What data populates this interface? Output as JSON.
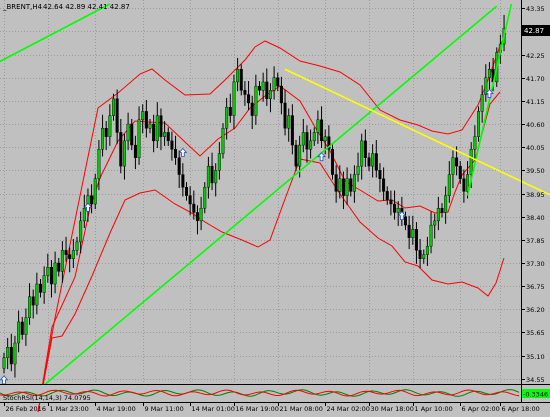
{
  "window_title": "_BRENT,H4",
  "ohlc_readout": "42.64 42.89 42.41 42.87",
  "current_price": "42.87",
  "indicator_label": "StochRSI(14,14,3) 74.0795",
  "indicator_value": "-0.3346",
  "colors": {
    "background": "#c0c0c0",
    "grid": "#9c9c9c",
    "bull": "#00c800",
    "bear": "#000000",
    "wick": "#000000",
    "bands": "#ff0000",
    "green_trend": "#00ff00",
    "yellow_trend": "#ffff00",
    "arrow": "#1e50c8",
    "price_tag_bg": "#000000",
    "price_tag_fg": "#ffffff",
    "indicator_value_bg": "#00ff00"
  },
  "chart_data": {
    "type": "candlestick",
    "symbol": "_BRENT",
    "timeframe": "H4",
    "ylim": [
      34.45,
      43.45
    ],
    "y_ticks": [
      "43.35",
      "42.80",
      "42.25",
      "41.70",
      "41.15",
      "40.60",
      "40.05",
      "39.50",
      "38.95",
      "38.40",
      "37.85",
      "37.30",
      "36.75",
      "36.20",
      "35.65",
      "35.10",
      "34.55"
    ],
    "x_ticks": [
      {
        "bar": 0,
        "label": "26 Feb 2016"
      },
      {
        "bar": 12,
        "label": "1 Mar 23:00"
      },
      {
        "bar": 25,
        "label": "4 Mar 19:00"
      },
      {
        "bar": 38,
        "label": "9 Mar 11:00"
      },
      {
        "bar": 51,
        "label": "14 Mar 01:00"
      },
      {
        "bar": 63,
        "label": "16 Mar 19:00"
      },
      {
        "bar": 75,
        "label": "21 Mar 08:00"
      },
      {
        "bar": 88,
        "label": "24 Mar 02:00"
      },
      {
        "bar": 100,
        "label": "30 Mar 18:00"
      },
      {
        "bar": 112,
        "label": "1 Apr 10:00"
      },
      {
        "bar": 125,
        "label": "6 Apr 02:00"
      },
      {
        "bar": 136,
        "label": "6 Apr 18:00"
      }
    ],
    "closes": [
      35.05,
      35.3,
      34.9,
      35.4,
      35.9,
      35.6,
      36.0,
      36.5,
      36.3,
      36.8,
      36.6,
      37.0,
      37.2,
      36.8,
      37.3,
      37.1,
      37.6,
      37.5,
      37.4,
      37.6,
      37.8,
      38.3,
      38.6,
      38.9,
      38.7,
      39.3,
      40.0,
      40.5,
      40.3,
      40.8,
      41.2,
      40.4,
      39.6,
      40.2,
      40.6,
      40.1,
      39.8,
      40.7,
      40.9,
      40.5,
      40.6,
      40.2,
      40.8,
      40.3,
      40.4,
      40.2,
      40.0,
      39.8,
      39.4,
      39.1,
      38.9,
      38.7,
      38.5,
      38.3,
      38.6,
      39.1,
      39.6,
      39.2,
      39.5,
      39.9,
      40.5,
      41.0,
      40.8,
      41.6,
      41.9,
      41.4,
      41.3,
      41.1,
      40.8,
      41.5,
      41.4,
      41.6,
      41.2,
      41.4,
      41.7,
      41.5,
      41.1,
      40.5,
      40.8,
      40.1,
      39.6,
      40.1,
      40.4,
      40.0,
      40.2,
      40.4,
      40.7,
      40.2,
      40.3,
      40.0,
      39.4,
      39.0,
      39.3,
      38.9,
      39.3,
      39.0,
      39.4,
      39.6,
      40.2,
      39.8,
      39.6,
      39.9,
      39.5,
      39.3,
      39.0,
      38.8,
      38.7,
      38.5,
      38.6,
      38.4,
      38.2,
      37.9,
      38.1,
      37.6,
      37.4,
      37.5,
      37.7,
      38.2,
      38.3,
      38.6,
      38.5,
      38.9,
      39.4,
      39.8,
      39.6,
      39.3,
      39.0,
      39.4,
      40.0,
      40.3,
      40.9,
      41.3,
      41.7,
      41.9,
      41.6,
      42.3,
      42.5,
      42.87
    ],
    "bollinger": {
      "upper": [
        [
          38,
          412
        ],
        [
          55,
          318
        ],
        [
          98,
          108
        ],
        [
          118,
          93
        ],
        [
          140,
          74
        ],
        [
          152,
          69
        ],
        [
          165,
          80
        ],
        [
          185,
          95
        ],
        [
          210,
          94
        ],
        [
          225,
          80
        ],
        [
          245,
          60
        ],
        [
          255,
          47
        ],
        [
          265,
          41
        ],
        [
          280,
          48
        ],
        [
          300,
          61
        ],
        [
          320,
          66
        ],
        [
          340,
          72
        ],
        [
          360,
          85
        ],
        [
          380,
          110
        ],
        [
          400,
          120
        ],
        [
          418,
          125
        ],
        [
          432,
          131
        ],
        [
          448,
          134
        ],
        [
          462,
          130
        ],
        [
          478,
          105
        ],
        [
          488,
          80
        ],
        [
          500,
          46
        ],
        [
          506,
          33
        ]
      ],
      "middle": [
        [
          38,
          412
        ],
        [
          52,
          327
        ],
        [
          75,
          277
        ],
        [
          90,
          208
        ],
        [
          100,
          178
        ],
        [
          118,
          141
        ],
        [
          135,
          121
        ],
        [
          148,
          122
        ],
        [
          165,
          123
        ],
        [
          185,
          142
        ],
        [
          200,
          156
        ],
        [
          218,
          139
        ],
        [
          235,
          128
        ],
        [
          250,
          108
        ],
        [
          265,
          96
        ],
        [
          280,
          86
        ],
        [
          300,
          101
        ],
        [
          315,
          127
        ],
        [
          330,
          151
        ],
        [
          345,
          181
        ],
        [
          360,
          190
        ],
        [
          378,
          201
        ],
        [
          392,
          200
        ],
        [
          405,
          208
        ],
        [
          420,
          206
        ],
        [
          435,
          213
        ],
        [
          448,
          212
        ],
        [
          455,
          192
        ],
        [
          462,
          175
        ],
        [
          475,
          160
        ],
        [
          490,
          104
        ],
        [
          500,
          92
        ]
      ],
      "lower": [
        [
          38,
          412
        ],
        [
          52,
          338
        ],
        [
          62,
          336
        ],
        [
          75,
          314
        ],
        [
          92,
          276
        ],
        [
          110,
          233
        ],
        [
          125,
          200
        ],
        [
          140,
          193
        ],
        [
          155,
          190
        ],
        [
          175,
          204
        ],
        [
          190,
          212
        ],
        [
          205,
          222
        ],
        [
          222,
          232
        ],
        [
          242,
          240
        ],
        [
          258,
          247
        ],
        [
          270,
          240
        ],
        [
          285,
          199
        ],
        [
          300,
          159
        ],
        [
          320,
          163
        ],
        [
          340,
          194
        ],
        [
          360,
          222
        ],
        [
          378,
          238
        ],
        [
          392,
          246
        ],
        [
          405,
          262
        ],
        [
          418,
          266
        ],
        [
          432,
          280
        ],
        [
          448,
          284
        ],
        [
          462,
          282
        ],
        [
          478,
          288
        ],
        [
          488,
          296
        ],
        [
          496,
          283
        ],
        [
          504,
          258
        ]
      ]
    },
    "trendlines": [
      {
        "color": "green",
        "from": {
          "bar": 11,
          "price": 34.4
        },
        "to": {
          "bar": 135,
          "price": 43.4
        }
      },
      {
        "color": "green",
        "from": {
          "bar": -3,
          "price": 42.0
        },
        "to": {
          "bar": 29,
          "price": 43.45
        }
      },
      {
        "color": "green",
        "from": {
          "bar": 127,
          "price": 38.9
        },
        "to": {
          "bar": 139,
          "price": 43.45
        }
      },
      {
        "color": "yellow",
        "from": {
          "bar": 77,
          "price": 41.9
        },
        "to": {
          "bar": 150,
          "price": 38.9
        }
      }
    ],
    "arrows": [
      {
        "bar": 0,
        "price": 34.5
      },
      {
        "bar": 23,
        "price": 38.6
      },
      {
        "bar": 49,
        "price": 39.9
      },
      {
        "bar": 87,
        "price": 39.8
      },
      {
        "bar": 109,
        "price": 38.4
      },
      {
        "bar": 133,
        "price": 41.3
      }
    ]
  }
}
